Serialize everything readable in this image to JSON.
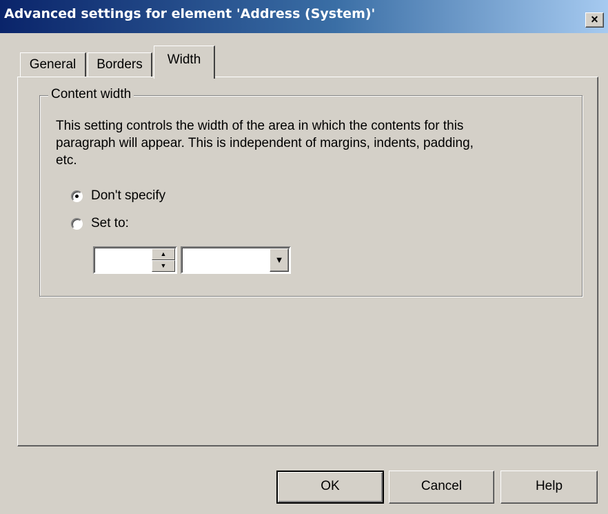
{
  "window": {
    "title": "Advanced settings for element 'Address (System)'",
    "close_label": "×"
  },
  "tabs": [
    {
      "label": "General",
      "selected": false
    },
    {
      "label": "Borders",
      "selected": false
    },
    {
      "label": "Width",
      "selected": true
    }
  ],
  "content_width": {
    "group_label": "Content width",
    "description": "This setting controls the width of the area in which the contents for this paragraph will appear.  This is independent of margins, indents, padding, etc.",
    "options": [
      {
        "label": "Don't specify",
        "checked": true
      },
      {
        "label": "Set to:",
        "checked": false
      }
    ],
    "value": "",
    "unit": ""
  },
  "buttons": {
    "ok": "OK",
    "cancel": "Cancel",
    "help": "Help"
  }
}
